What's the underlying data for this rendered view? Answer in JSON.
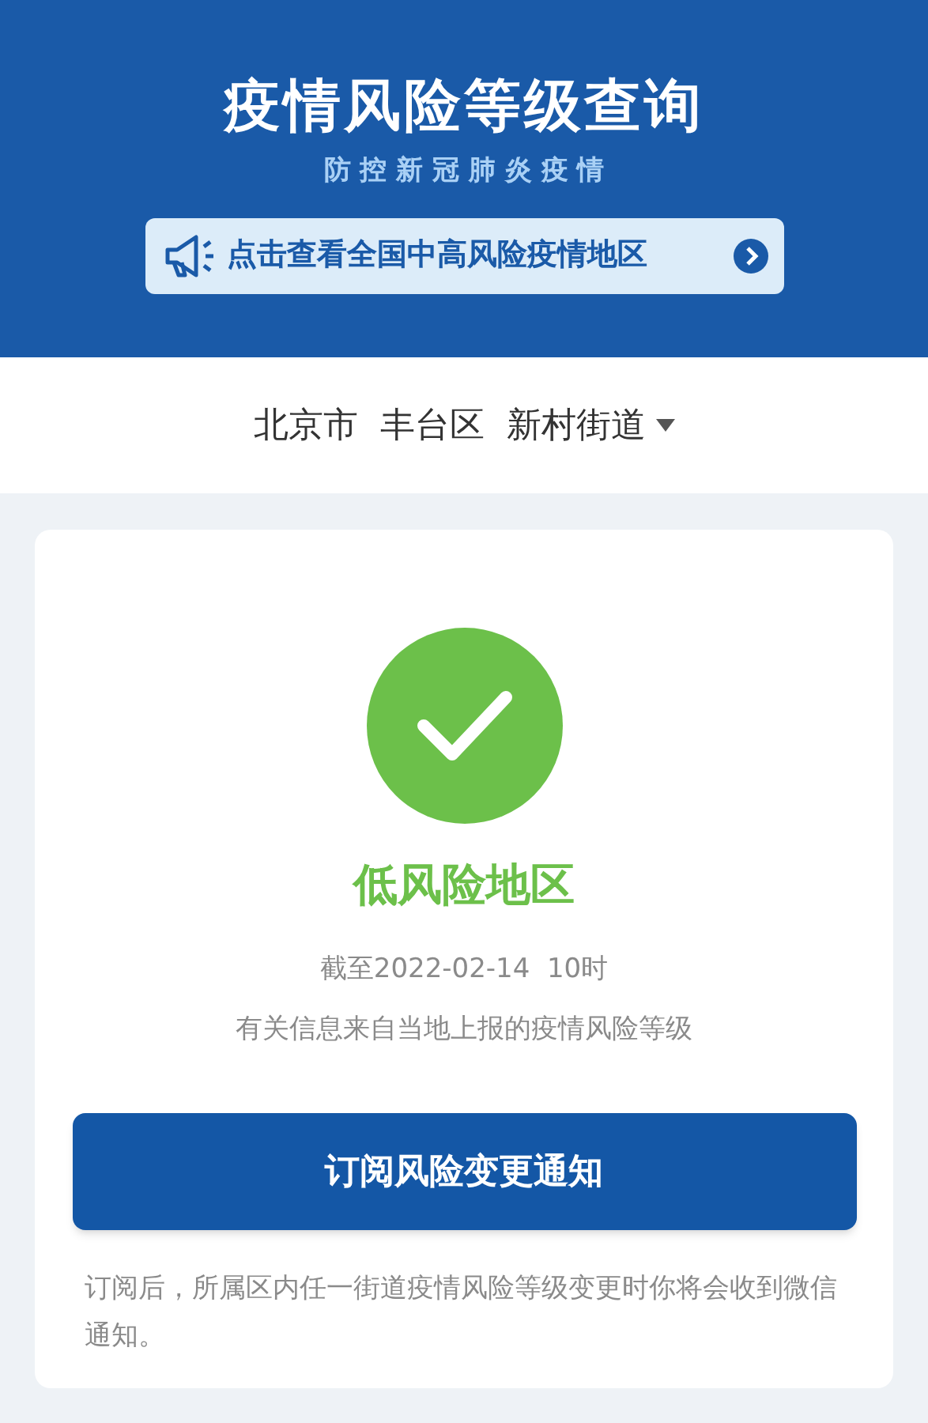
{
  "header": {
    "title": "疫情风险等级查询",
    "subtitle": "防 控 新 冠 肺 炎 疫 情",
    "banner": "点击查看全国中高风险疫情地区"
  },
  "location": [
    "北京市",
    "丰台区",
    "新村街道"
  ],
  "result": {
    "kind": "low",
    "label": "低风险地区",
    "as_of": "截至2022-02-14  10时",
    "source": "有关信息来自当地上报的疫情风险等级"
  },
  "subscribe_button": "订阅风险变更通知",
  "note": "订阅后，所属区内任一街道疫情风险等级变更时你将会收到微信通知。"
}
